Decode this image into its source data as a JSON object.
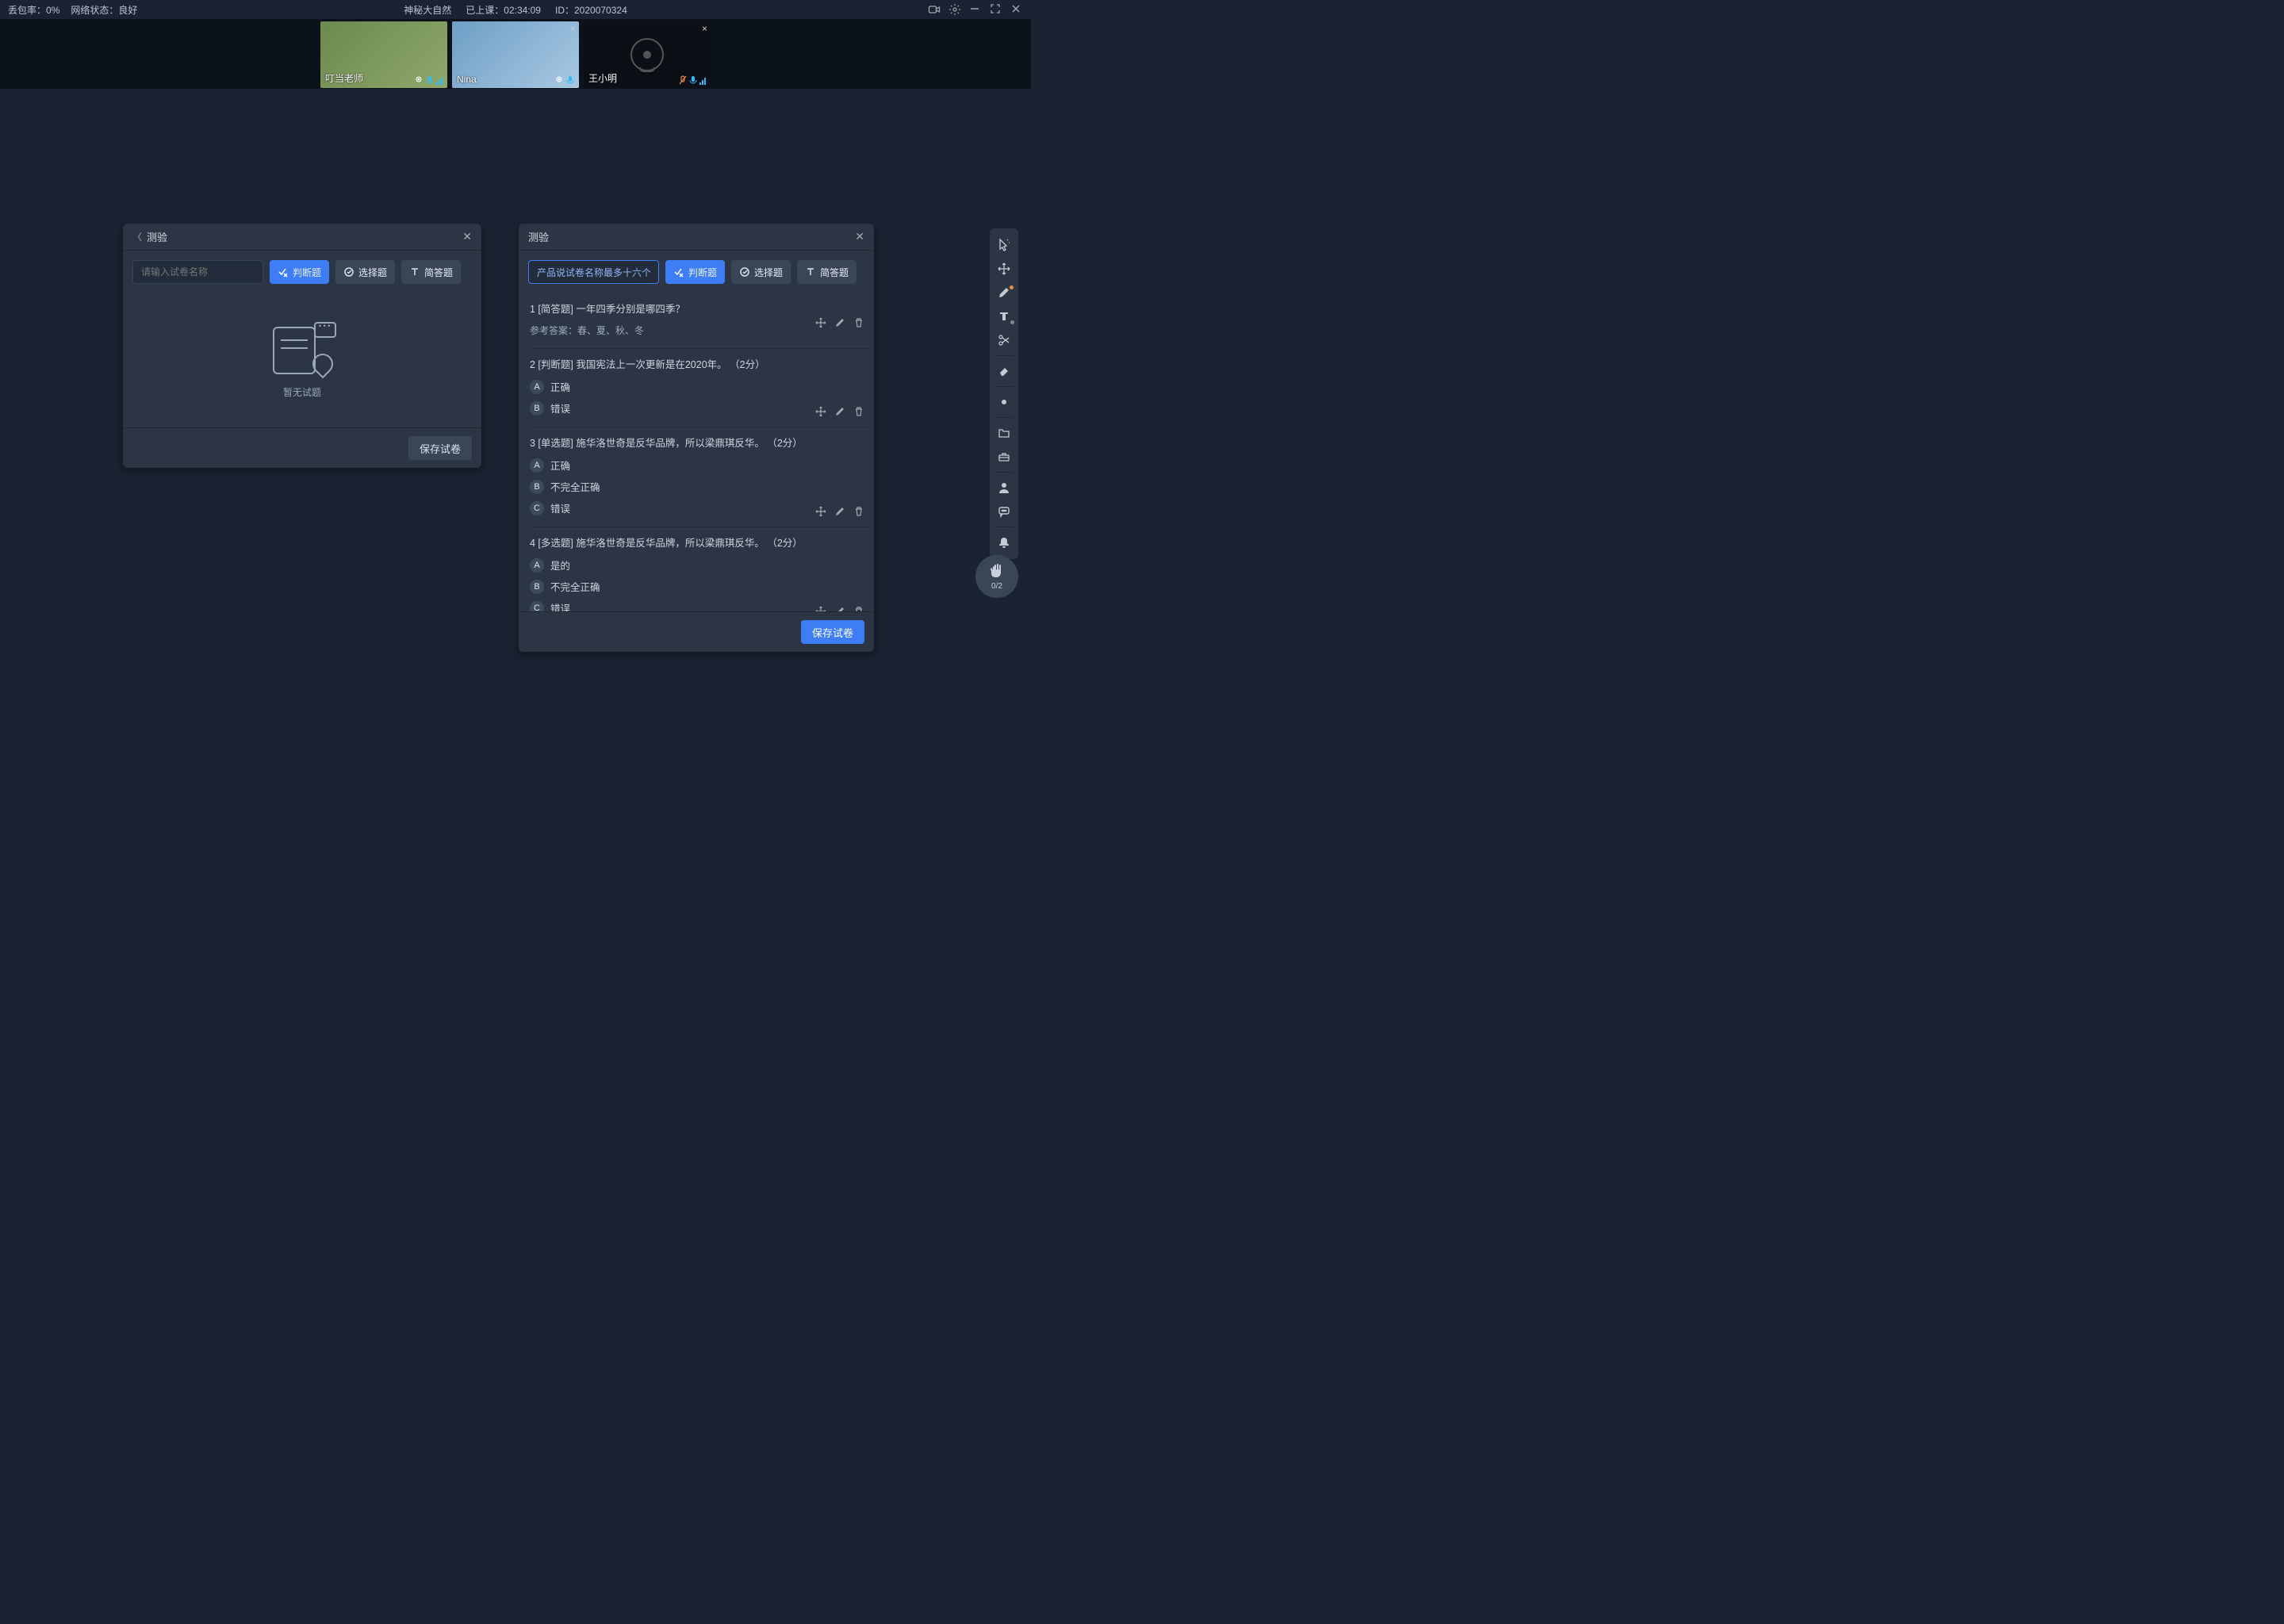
{
  "top": {
    "loss_label": "丢包率：",
    "loss_value": "0%",
    "net_label": "网络状态：",
    "net_value": "良好",
    "class_title": "神秘大自然",
    "elapsed_label": "已上课：",
    "elapsed_value": "02:34:09",
    "id_label": "ID：",
    "id_value": "2020070324"
  },
  "participants": [
    {
      "name": "叮当老师",
      "camera": true
    },
    {
      "name": "Nina",
      "camera": true,
      "closable": true
    },
    {
      "name": "王小明",
      "camera": false,
      "closable": true
    }
  ],
  "panel1": {
    "title": "测验",
    "placeholder": "请输入试卷名称",
    "btn_tf": "判断题",
    "btn_choice": "选择题",
    "btn_short": "简答题",
    "empty_text": "暂无试题",
    "save": "保存试卷"
  },
  "panel2": {
    "title": "测验",
    "name_value": "产品说试卷名称最多十六个字",
    "btn_tf": "判断题",
    "btn_choice": "选择题",
    "btn_short": "简答题",
    "save": "保存试卷",
    "questions": [
      {
        "no": "1",
        "tag": "[简答题]",
        "text": "一年四季分别是哪四季？",
        "ref": "参考答案：春、夏、秋、冬"
      },
      {
        "no": "2",
        "tag": "[判断题]",
        "text": "我国宪法上一次更新是在2020年。",
        "score": "（2分）",
        "options": [
          {
            "k": "A",
            "v": "正确"
          },
          {
            "k": "B",
            "v": "错误"
          }
        ]
      },
      {
        "no": "3",
        "tag": "[单选题]",
        "text": "施华洛世奇是反华品牌，所以梁鼎琪反华。",
        "score": "（2分）",
        "options": [
          {
            "k": "A",
            "v": "正确"
          },
          {
            "k": "B",
            "v": "不完全正确"
          },
          {
            "k": "C",
            "v": "错误"
          }
        ]
      },
      {
        "no": "4",
        "tag": "[多选题]",
        "text": "施华洛世奇是反华品牌，所以梁鼎琪反华。",
        "score": "（2分）",
        "options": [
          {
            "k": "A",
            "v": "是的"
          },
          {
            "k": "B",
            "v": "不完全正确"
          },
          {
            "k": "C",
            "v": "错误"
          }
        ]
      }
    ]
  },
  "hand": {
    "count": "0/2"
  }
}
